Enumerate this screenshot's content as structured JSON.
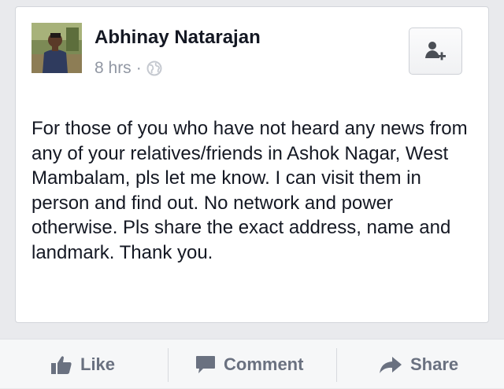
{
  "post": {
    "author": "Abhinay Natarajan",
    "time": "8 hrs",
    "separator": "·",
    "privacy_icon": "globe-icon",
    "add_friend_icon": "add-friend-icon",
    "text": "For those of you who have not heard any news from any of your relatives/friends in Ashok Nagar, West Mambalam, pls let me know. I can visit them in person and find out. No network and power otherwise. Pls share the exact address, name and landmark. Thank you."
  },
  "actions": {
    "like_label": "Like",
    "like_icon": "thumbs-up-icon",
    "comment_label": "Comment",
    "comment_icon": "speech-bubble-icon",
    "share_label": "Share",
    "share_icon": "share-arrow-icon"
  },
  "colors": {
    "background": "#e9eaed",
    "card": "#ffffff",
    "author_text": "#141823",
    "meta_text": "#9197a3",
    "action_text": "#6a7180"
  }
}
